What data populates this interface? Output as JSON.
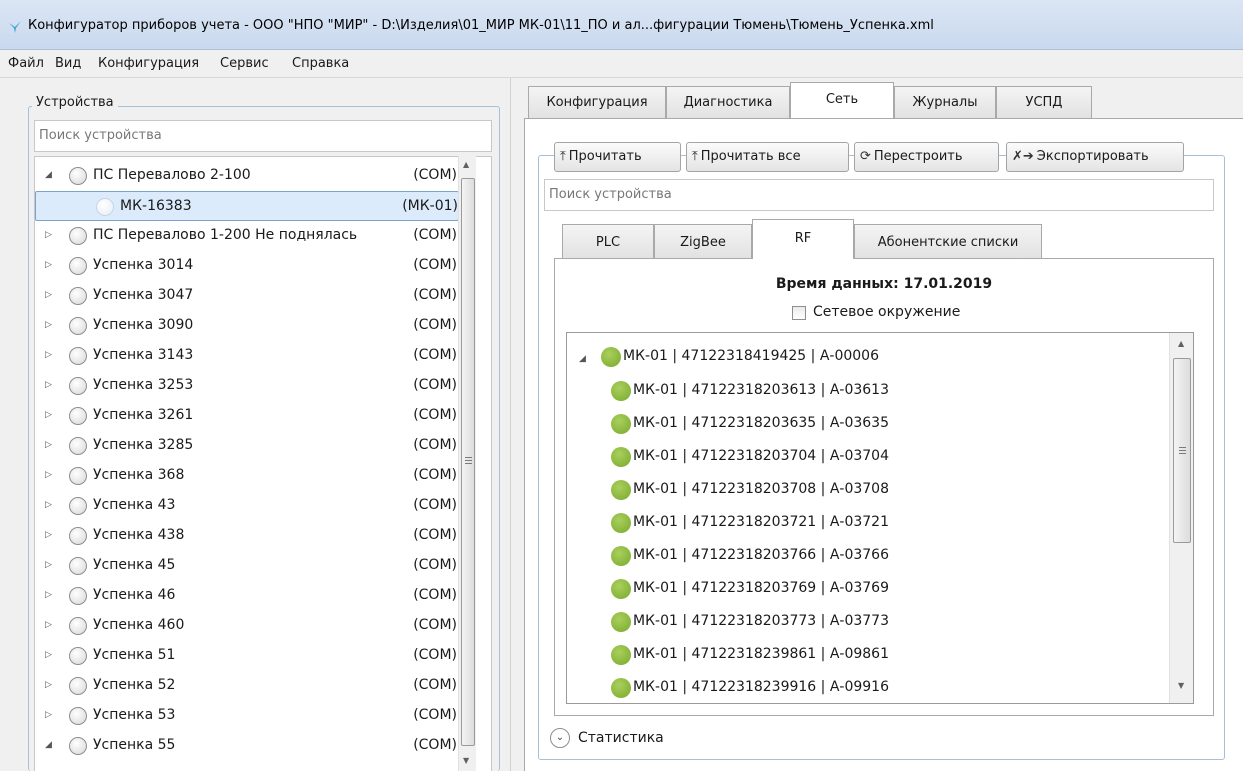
{
  "window": {
    "title": "Конфигуратор приборов учета - ООО \"НПО \"МИР\" - D:\\Изделия\\01_МИР МК-01\\11_ПО и ал...фигурации Тюмень\\Тюмень_Успенка.xml"
  },
  "menu": [
    "Файл",
    "Вид",
    "Конфигурация",
    "Сервис",
    "Справка"
  ],
  "devices": {
    "legend": "Устройства",
    "search_placeholder": "Поиск устройства",
    "items": [
      {
        "name": "ПС Перевалово  2-100",
        "type": "(COM)",
        "expander": "expanded"
      },
      {
        "name": "МК-16383",
        "type": "(МК-01)",
        "expander": "none",
        "selected": true
      },
      {
        "name": "ПС Перевалово 1-200 Не поднялась",
        "type": "(COM)",
        "expander": "collapsed"
      },
      {
        "name": "Успенка 3014",
        "type": "(COM)",
        "expander": "collapsed"
      },
      {
        "name": "Успенка 3047",
        "type": "(COM)",
        "expander": "collapsed"
      },
      {
        "name": "Успенка 3090",
        "type": "(COM)",
        "expander": "collapsed"
      },
      {
        "name": "Успенка 3143",
        "type": "(COM)",
        "expander": "collapsed"
      },
      {
        "name": "Успенка 3253",
        "type": "(COM)",
        "expander": "collapsed"
      },
      {
        "name": "Успенка 3261",
        "type": "(COM)",
        "expander": "collapsed"
      },
      {
        "name": "Успенка 3285",
        "type": "(COM)",
        "expander": "collapsed"
      },
      {
        "name": "Успенка 368",
        "type": "(COM)",
        "expander": "collapsed"
      },
      {
        "name": "Успенка 43",
        "type": "(COM)",
        "expander": "collapsed"
      },
      {
        "name": "Успенка 438",
        "type": "(COM)",
        "expander": "collapsed"
      },
      {
        "name": "Успенка 45",
        "type": "(COM)",
        "expander": "collapsed"
      },
      {
        "name": "Успенка 46",
        "type": "(COM)",
        "expander": "collapsed"
      },
      {
        "name": "Успенка 460",
        "type": "(COM)",
        "expander": "collapsed"
      },
      {
        "name": "Успенка 51",
        "type": "(COM)",
        "expander": "collapsed"
      },
      {
        "name": "Успенка 52",
        "type": "(COM)",
        "expander": "collapsed"
      },
      {
        "name": "Успенка 53",
        "type": "(COM)",
        "expander": "collapsed"
      },
      {
        "name": "Успенка 55",
        "type": "(COM)",
        "expander": "expanded"
      }
    ]
  },
  "tabs": [
    "Конфигурация",
    "Диагностика",
    "Сеть",
    "Журналы",
    "УСПД"
  ],
  "active_tab": "Сеть",
  "toolbar": {
    "read": "Прочитать",
    "read_all": "Прочитать все",
    "rebuild": "Перестроить",
    "export": "Экспортировать"
  },
  "network": {
    "search_placeholder": "Поиск устройства",
    "subtabs": [
      "PLC",
      "ZigBee",
      "RF",
      "Абонентские списки"
    ],
    "active_subtab": "RF",
    "data_time": "Время данных: 17.01.2019",
    "net_env_label": "Сетевое окружение",
    "net_env_checked": false,
    "root": "МК-01 | 47122318419425 | А-00006",
    "children": [
      "МК-01 | 47122318203613 | А-03613",
      "МК-01 | 47122318203635 | А-03635",
      "МК-01 | 47122318203704 | А-03704",
      "МК-01 | 47122318203708 | А-03708",
      "МК-01 | 47122318203721 | А-03721",
      "МК-01 | 47122318203766 | А-03766",
      "МК-01 | 47122318203769 | А-03769",
      "МК-01 | 47122318203773 | А-03773",
      "МК-01 | 47122318239861 | А-09861",
      "МК-01 | 47122318239916 | А-09916"
    ],
    "statistics_label": "Статистика"
  },
  "colors": {
    "accent": "#7da2ce",
    "status_green": "#8cbb3c",
    "status_gray": "#d6d6d6"
  }
}
